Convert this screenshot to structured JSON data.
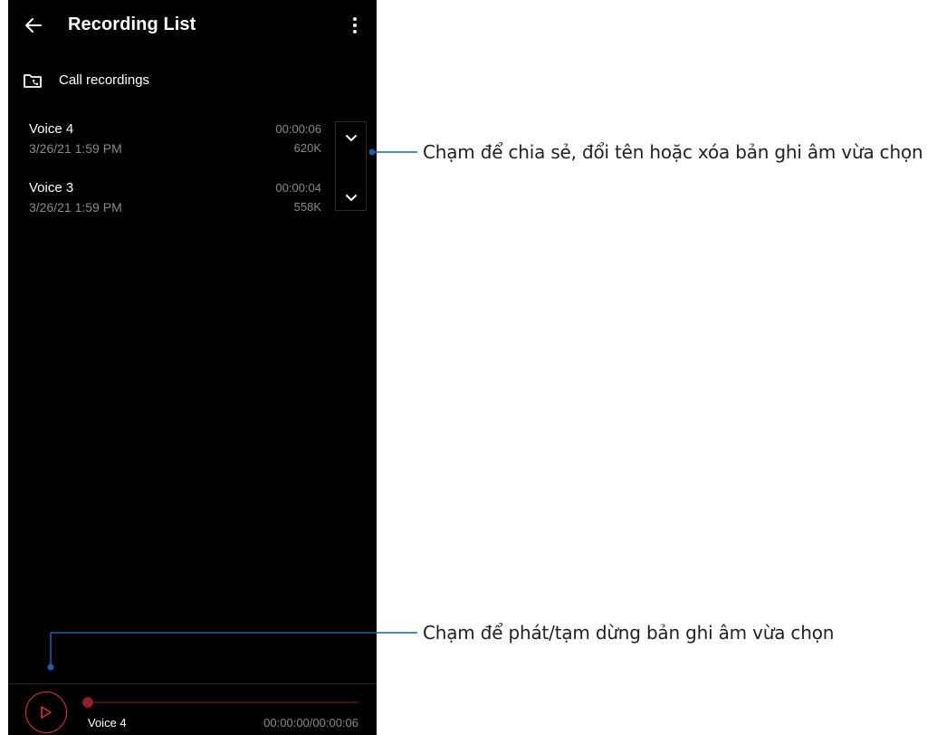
{
  "appbar": {
    "title": "Recording List",
    "back_icon": "arrow-left-icon",
    "more_icon": "more-vert-icon"
  },
  "folder": {
    "icon": "folder-phone-icon",
    "label": "Call recordings"
  },
  "recordings": [
    {
      "name": "Voice 4",
      "date": "3/26/21 1:59 PM",
      "duration": "00:00:06",
      "size": "620K"
    },
    {
      "name": "Voice 3",
      "date": "3/26/21 1:59 PM",
      "duration": "00:00:04",
      "size": "558K"
    }
  ],
  "player": {
    "track_name": "Voice 4",
    "time": "00:00:00/00:00:06",
    "progress": 0,
    "accent_color": "#d8323c"
  },
  "callouts": {
    "expand": "Chạm để chia sẻ, đổi tên hoặc xóa bản ghi âm vừa chọn",
    "play": "Chạm để phát/tạm dừng bản ghi âm vừa chọn",
    "line_color": "#1f5fa8"
  }
}
